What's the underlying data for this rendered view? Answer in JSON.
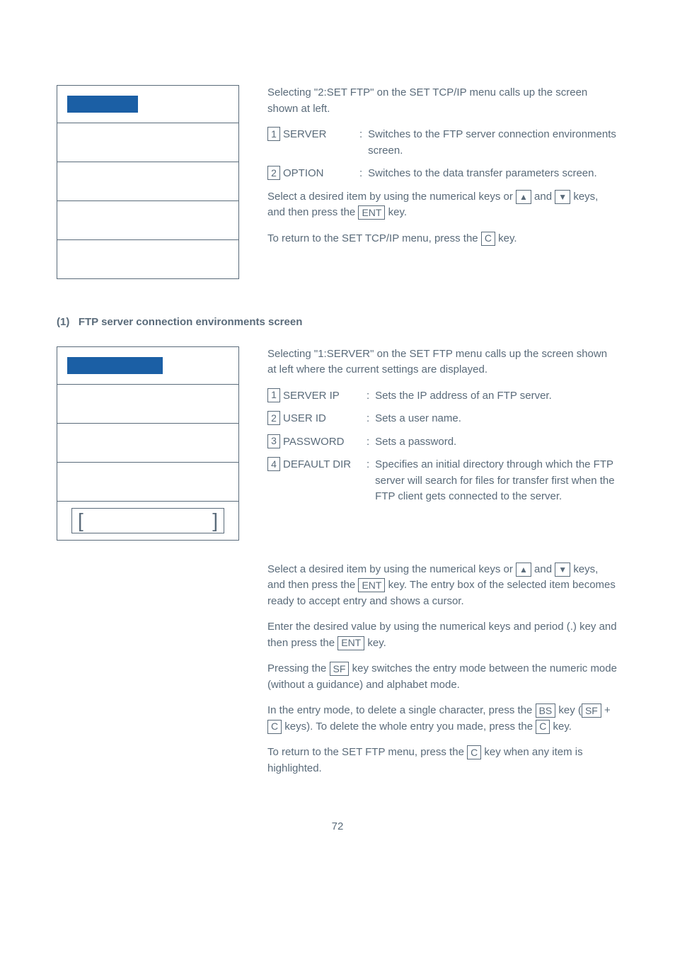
{
  "section1": {
    "intro": "Selecting \"2:SET FTP\" on the SET TCP/IP menu calls up the screen shown at left.",
    "options": [
      {
        "num": "1",
        "label": "SERVER",
        "desc": "Switches to the FTP server connection environments screen."
      },
      {
        "num": "2",
        "label": "OPTION",
        "desc": "Switches to the data transfer parameters screen."
      }
    ],
    "select_text_1": "Select a desired item by using the numerical keys or ",
    "select_text_2": " and ",
    "select_text_3": " keys, and then press the ",
    "select_text_4": " key.",
    "return_text_1": "To return to the SET TCP/IP menu, press the ",
    "return_text_2": " key.",
    "ent_key": "ENT",
    "c_key": "C",
    "up_arrow": "▲",
    "down_arrow": "▼"
  },
  "heading_num": "(1)",
  "heading_text": "FTP server connection environments screen",
  "section2": {
    "intro": "Selecting \"1:SERVER\" on the SET FTP menu calls up the screen shown at left where the current settings are displayed.",
    "options": [
      {
        "num": "1",
        "label": "SERVER IP",
        "desc": "Sets the IP address of an FTP server."
      },
      {
        "num": "2",
        "label": "USER ID",
        "desc": "Sets a user name."
      },
      {
        "num": "3",
        "label": "PASSWORD",
        "desc": "Sets a password."
      },
      {
        "num": "4",
        "label": "DEFAULT DIR",
        "desc": "Specifies an initial directory through which the FTP server will search for files for transfer first when the FTP client gets connected to the server."
      }
    ],
    "para1_a": "Select a desired item by using the numerical keys or ",
    "para1_b": " and ",
    "para1_c": " keys, and then press the ",
    "para1_d": " key. The entry box of the selected item becomes ready to accept entry and shows a cursor.",
    "para2_a": "Enter the desired value by using the numerical keys and period (.) key and then press the ",
    "para2_b": " key.",
    "para3_a": "Pressing the ",
    "para3_b": " key switches the entry mode between the numeric mode (without a guidance) and alphabet mode.",
    "para4_a": "In the entry mode, to delete a single character, press the ",
    "para4_b": " key (",
    "para4_c": " + ",
    "para4_d": " keys).  To delete the whole entry you made, press the ",
    "para4_e": " key.",
    "para5_a": "To return to the SET FTP menu, press the ",
    "para5_b": " key when any item is highlighted.",
    "ent_key": "ENT",
    "c_key": "C",
    "sf_key": "SF",
    "bs_key": "BS",
    "up_arrow": "▲",
    "down_arrow": "▼"
  },
  "page_number": "72"
}
